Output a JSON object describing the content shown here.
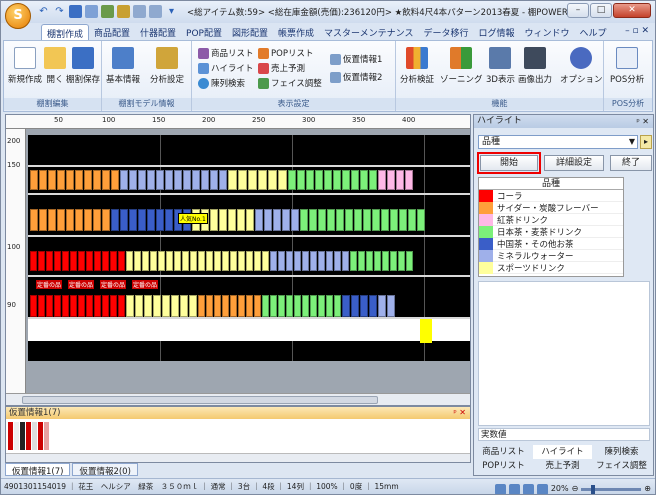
{
  "titlebar": {
    "orb": "S",
    "title": "<総アイテム数:59> <総在庫金額(売価):236120円> ★飲料4尺4本パターン2013春夏 - 棚POWER",
    "minimize": "–",
    "maximize": "□",
    "close": "✕"
  },
  "ribbon_tabs": {
    "items": [
      "棚割作成",
      "商品配置",
      "什器配置",
      "POP配置",
      "図形配置",
      "帳票作成",
      "マスターメンテナンス",
      "データ移行",
      "ログ情報",
      "ウィンドウ",
      "ヘルプ"
    ],
    "right": "– ▫ ✕"
  },
  "ribbon": {
    "groups": {
      "edit": {
        "label": "棚割編集",
        "new": "新規作成",
        "open": "開く",
        "save": "棚割保存"
      },
      "model": {
        "label": "棚割モデル情報",
        "basic": "基本情報",
        "analysis": "分析設定"
      },
      "display": {
        "label": "表示設定",
        "item_list": "商品リスト",
        "pop_list": "POPリスト",
        "highlight": "ハイライト",
        "sales_forecast": "売上予測",
        "display_search": "陳列検索",
        "face_adjust": "フェイス調整",
        "virtual1": "仮置情報1",
        "virtual2": "仮置情報2"
      },
      "function": {
        "label": "機能",
        "analysis_verify": "分析検証",
        "zoning": "ゾーニング",
        "display3d": "3D表示",
        "image_out": "画像出力",
        "option": "オプション"
      },
      "pos": {
        "label": "POS分析",
        "pos": "POS分析"
      }
    }
  },
  "canvas": {
    "ruler_top": [
      "50",
      "100",
      "150",
      "200",
      "250",
      "300",
      "350",
      "400"
    ],
    "ruler_left": [
      "200",
      "150",
      "100",
      "90"
    ],
    "pop_tag": "人気No.1",
    "pop_labels": [
      "定番の品",
      "定番の品",
      "定番の品",
      "定番の品"
    ]
  },
  "bottom_panel": {
    "title": "仮置情報1(7)",
    "pin": "ᵖ ✕",
    "tabs": [
      "仮置情報1(7)",
      "仮置情報2(0)"
    ]
  },
  "statusbar": {
    "text": "4901301154019 ｜ 花王　ヘルシア　緑茶　３５０ｍｌ ｜ 通常 ｜ 3台 ｜ 4段 ｜ 14列 ｜ 100% ｜ 0度 ｜ 15mm",
    "zoom": "20%"
  },
  "highlight_panel": {
    "title": "ハイライト",
    "pin": "ᵖ ✕",
    "select_value": "品種",
    "start": "開始",
    "detail": "詳細設定",
    "end": "終了",
    "legend_header": "品種",
    "legend": [
      {
        "label": "コーラ",
        "color": "#ff0000"
      },
      {
        "label": "サイダー・炭酸フレーバー",
        "color": "#ff9f3a"
      },
      {
        "label": "紅茶ドリンク",
        "color": "#ffb8e6"
      },
      {
        "label": "日本茶・麦茶ドリンク",
        "color": "#7cf07a"
      },
      {
        "label": "中国茶・その他お茶",
        "color": "#3a5ec8"
      },
      {
        "label": "ミネラルウォーター",
        "color": "#9fb0ea"
      },
      {
        "label": "スポーツドリンク",
        "color": "#ffff9c"
      }
    ],
    "count_label": "実数値",
    "tabs": [
      "商品リスト",
      "ハイライト",
      "陳列検索",
      "POPリスト",
      "売上予測",
      "フェイス調整"
    ]
  }
}
